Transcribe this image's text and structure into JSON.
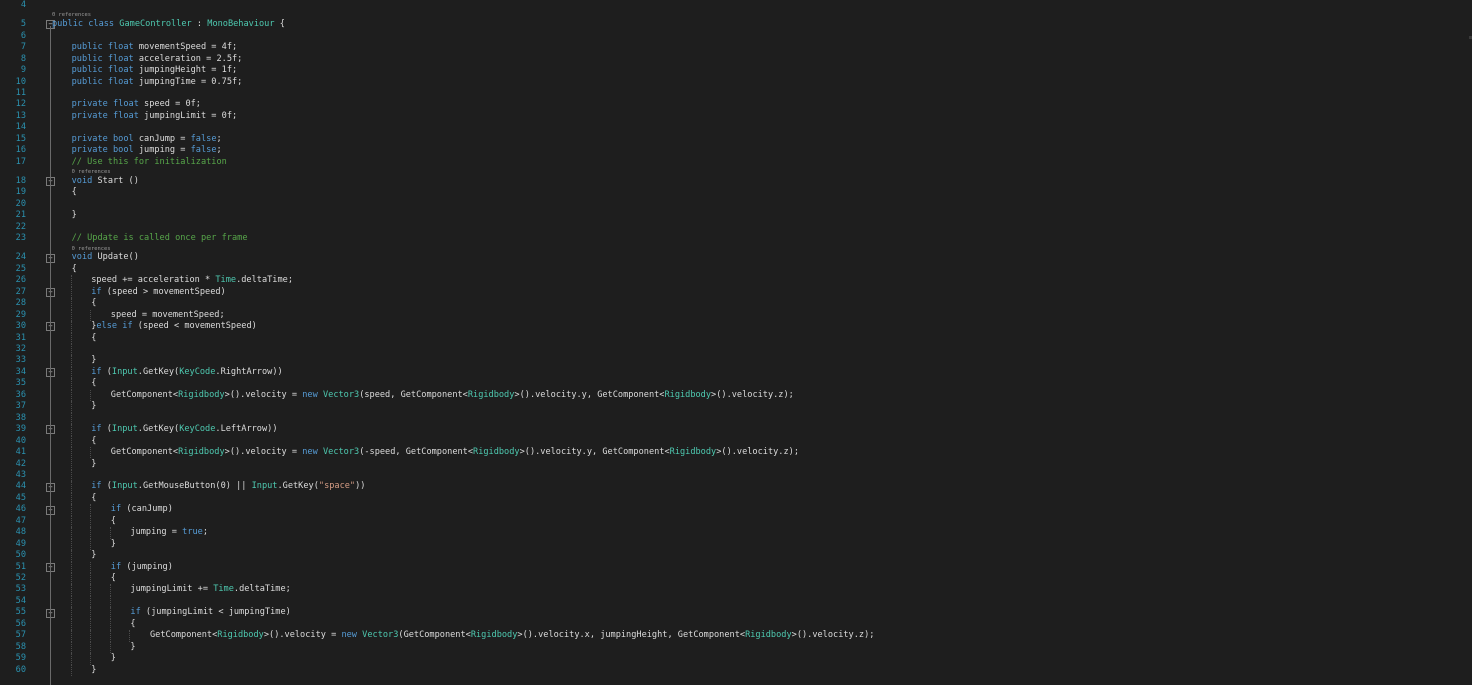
{
  "editor": {
    "language": "C#",
    "colors": {
      "background": "#1e1e1e",
      "line_number": "#2b91af",
      "keyword": "#569cd6",
      "type": "#4ec9b0",
      "comment": "#57a64a",
      "string": "#d69d85",
      "number": "#b5cea8",
      "text": "#dcdcdc",
      "codelens": "#999999"
    },
    "lines": [
      {
        "n": "4",
        "indent": 0,
        "tokens": []
      },
      {
        "lens": "0 references",
        "indent": 0
      },
      {
        "n": "5",
        "indent": 0,
        "fold": "minus",
        "tokens": [
          [
            "kw",
            "public"
          ],
          [
            "plain",
            " "
          ],
          [
            "kw",
            "class"
          ],
          [
            "plain",
            " "
          ],
          [
            "type",
            "GameController"
          ],
          [
            "plain",
            " : "
          ],
          [
            "type",
            "MonoBehaviour"
          ],
          [
            "plain",
            " {"
          ]
        ]
      },
      {
        "n": "6",
        "indent": 0,
        "tokens": []
      },
      {
        "n": "7",
        "indent": 1,
        "tokens": [
          [
            "kw",
            "public"
          ],
          [
            "plain",
            " "
          ],
          [
            "kw",
            "float"
          ],
          [
            "plain",
            " movementSpeed = 4f;"
          ]
        ]
      },
      {
        "n": "8",
        "indent": 1,
        "tokens": [
          [
            "kw",
            "public"
          ],
          [
            "plain",
            " "
          ],
          [
            "kw",
            "float"
          ],
          [
            "plain",
            " acceleration = 2.5f;"
          ]
        ]
      },
      {
        "n": "9",
        "indent": 1,
        "tokens": [
          [
            "kw",
            "public"
          ],
          [
            "plain",
            " "
          ],
          [
            "kw",
            "float"
          ],
          [
            "plain",
            " jumpingHeight = 1f;"
          ]
        ]
      },
      {
        "n": "10",
        "indent": 1,
        "tokens": [
          [
            "kw",
            "public"
          ],
          [
            "plain",
            " "
          ],
          [
            "kw",
            "float"
          ],
          [
            "plain",
            " jumpingTime = 0.75f;"
          ]
        ]
      },
      {
        "n": "11",
        "indent": 1,
        "tokens": []
      },
      {
        "n": "12",
        "indent": 1,
        "tokens": [
          [
            "kw",
            "private"
          ],
          [
            "plain",
            " "
          ],
          [
            "kw",
            "float"
          ],
          [
            "plain",
            " speed = 0f;"
          ]
        ]
      },
      {
        "n": "13",
        "indent": 1,
        "tokens": [
          [
            "kw",
            "private"
          ],
          [
            "plain",
            " "
          ],
          [
            "kw",
            "float"
          ],
          [
            "plain",
            " jumpingLimit = 0f;"
          ]
        ]
      },
      {
        "n": "14",
        "indent": 1,
        "tokens": []
      },
      {
        "n": "15",
        "indent": 1,
        "tokens": [
          [
            "kw",
            "private"
          ],
          [
            "plain",
            " "
          ],
          [
            "kw",
            "bool"
          ],
          [
            "plain",
            " canJump = "
          ],
          [
            "kw",
            "false"
          ],
          [
            "plain",
            ";"
          ]
        ]
      },
      {
        "n": "16",
        "indent": 1,
        "tokens": [
          [
            "kw",
            "private"
          ],
          [
            "plain",
            " "
          ],
          [
            "kw",
            "bool"
          ],
          [
            "plain",
            " jumping = "
          ],
          [
            "kw",
            "false"
          ],
          [
            "plain",
            ";"
          ]
        ]
      },
      {
        "n": "17",
        "indent": 1,
        "tokens": [
          [
            "com",
            "// Use this for initialization"
          ]
        ]
      },
      {
        "lens": "0 references",
        "indent": 1
      },
      {
        "n": "18",
        "indent": 1,
        "fold": "minus",
        "tokens": [
          [
            "kw",
            "void"
          ],
          [
            "plain",
            " Start ()"
          ]
        ]
      },
      {
        "n": "19",
        "indent": 1,
        "tokens": [
          [
            "plain",
            "{"
          ]
        ]
      },
      {
        "n": "20",
        "indent": 1,
        "tokens": []
      },
      {
        "n": "21",
        "indent": 1,
        "tokens": [
          [
            "plain",
            "}"
          ]
        ]
      },
      {
        "n": "22",
        "indent": 1,
        "tokens": []
      },
      {
        "n": "23",
        "indent": 1,
        "tokens": [
          [
            "com",
            "// Update is called once per frame"
          ]
        ]
      },
      {
        "lens": "0 references",
        "indent": 1
      },
      {
        "n": "24",
        "indent": 1,
        "fold": "minus",
        "tokens": [
          [
            "kw",
            "void"
          ],
          [
            "plain",
            " Update()"
          ]
        ]
      },
      {
        "n": "25",
        "indent": 1,
        "tokens": [
          [
            "plain",
            "{"
          ]
        ]
      },
      {
        "n": "26",
        "indent": 2,
        "tokens": [
          [
            "plain",
            "speed += acceleration * "
          ],
          [
            "type",
            "Time"
          ],
          [
            "plain",
            ".deltaTime;"
          ]
        ]
      },
      {
        "n": "27",
        "indent": 2,
        "fold": "minus",
        "tokens": [
          [
            "kw",
            "if"
          ],
          [
            "plain",
            " (speed > movementSpeed)"
          ]
        ]
      },
      {
        "n": "28",
        "indent": 2,
        "tokens": [
          [
            "plain",
            "{"
          ]
        ]
      },
      {
        "n": "29",
        "indent": 3,
        "tokens": [
          [
            "plain",
            "speed = movementSpeed;"
          ]
        ]
      },
      {
        "n": "30",
        "indent": 2,
        "fold": "minus",
        "tokens": [
          [
            "plain",
            "}"
          ],
          [
            "kw",
            "else"
          ],
          [
            "plain",
            " "
          ],
          [
            "kw",
            "if"
          ],
          [
            "plain",
            " (speed < movementSpeed)"
          ]
        ]
      },
      {
        "n": "31",
        "indent": 2,
        "tokens": [
          [
            "plain",
            "{"
          ]
        ]
      },
      {
        "n": "32",
        "indent": 2,
        "tokens": []
      },
      {
        "n": "33",
        "indent": 2,
        "tokens": [
          [
            "plain",
            "}"
          ]
        ]
      },
      {
        "n": "34",
        "indent": 2,
        "fold": "minus",
        "tokens": [
          [
            "kw",
            "if"
          ],
          [
            "plain",
            " ("
          ],
          [
            "type",
            "Input"
          ],
          [
            "plain",
            ".GetKey("
          ],
          [
            "type",
            "KeyCode"
          ],
          [
            "plain",
            ".RightArrow))"
          ]
        ]
      },
      {
        "n": "35",
        "indent": 2,
        "tokens": [
          [
            "plain",
            "{"
          ]
        ]
      },
      {
        "n": "36",
        "indent": 3,
        "tokens": [
          [
            "plain",
            "GetComponent<"
          ],
          [
            "type",
            "Rigidbody"
          ],
          [
            "plain",
            ">().velocity = "
          ],
          [
            "kw",
            "new"
          ],
          [
            "plain",
            " "
          ],
          [
            "type",
            "Vector3"
          ],
          [
            "plain",
            "(speed, GetComponent<"
          ],
          [
            "type",
            "Rigidbody"
          ],
          [
            "plain",
            ">().velocity.y, GetComponent<"
          ],
          [
            "type",
            "Rigidbody"
          ],
          [
            "plain",
            ">().velocity.z);"
          ]
        ]
      },
      {
        "n": "37",
        "indent": 2,
        "tokens": [
          [
            "plain",
            "}"
          ]
        ]
      },
      {
        "n": "38",
        "indent": 2,
        "tokens": []
      },
      {
        "n": "39",
        "indent": 2,
        "fold": "minus",
        "tokens": [
          [
            "kw",
            "if"
          ],
          [
            "plain",
            " ("
          ],
          [
            "type",
            "Input"
          ],
          [
            "plain",
            ".GetKey("
          ],
          [
            "type",
            "KeyCode"
          ],
          [
            "plain",
            ".LeftArrow))"
          ]
        ]
      },
      {
        "n": "40",
        "indent": 2,
        "tokens": [
          [
            "plain",
            "{"
          ]
        ]
      },
      {
        "n": "41",
        "indent": 3,
        "tokens": [
          [
            "plain",
            "GetComponent<"
          ],
          [
            "type",
            "Rigidbody"
          ],
          [
            "plain",
            ">().velocity = "
          ],
          [
            "kw",
            "new"
          ],
          [
            "plain",
            " "
          ],
          [
            "type",
            "Vector3"
          ],
          [
            "plain",
            "(-speed, GetComponent<"
          ],
          [
            "type",
            "Rigidbody"
          ],
          [
            "plain",
            ">().velocity.y, GetComponent<"
          ],
          [
            "type",
            "Rigidbody"
          ],
          [
            "plain",
            ">().velocity.z);"
          ]
        ]
      },
      {
        "n": "42",
        "indent": 2,
        "tokens": [
          [
            "plain",
            "}"
          ]
        ]
      },
      {
        "n": "43",
        "indent": 2,
        "tokens": []
      },
      {
        "n": "44",
        "indent": 2,
        "fold": "minus",
        "tokens": [
          [
            "kw",
            "if"
          ],
          [
            "plain",
            " ("
          ],
          [
            "type",
            "Input"
          ],
          [
            "plain",
            ".GetMouseButton(0) || "
          ],
          [
            "type",
            "Input"
          ],
          [
            "plain",
            ".GetKey("
          ],
          [
            "str",
            "\"space\""
          ],
          [
            "plain",
            "))"
          ]
        ]
      },
      {
        "n": "45",
        "indent": 2,
        "tokens": [
          [
            "plain",
            "{"
          ]
        ]
      },
      {
        "n": "46",
        "indent": 3,
        "fold": "minus",
        "tokens": [
          [
            "kw",
            "if"
          ],
          [
            "plain",
            " (canJump)"
          ]
        ]
      },
      {
        "n": "47",
        "indent": 3,
        "tokens": [
          [
            "plain",
            "{"
          ]
        ]
      },
      {
        "n": "48",
        "indent": 4,
        "tokens": [
          [
            "plain",
            "jumping = "
          ],
          [
            "kw",
            "true"
          ],
          [
            "plain",
            ";"
          ]
        ]
      },
      {
        "n": "49",
        "indent": 3,
        "tokens": [
          [
            "plain",
            "}"
          ]
        ]
      },
      {
        "n": "50",
        "indent": 2,
        "tokens": [
          [
            "plain",
            "}"
          ]
        ]
      },
      {
        "n": "51",
        "indent": 3,
        "fold": "minus",
        "tokens": [
          [
            "kw",
            "if"
          ],
          [
            "plain",
            " (jumping)"
          ]
        ]
      },
      {
        "n": "52",
        "indent": 3,
        "tokens": [
          [
            "plain",
            "{"
          ]
        ]
      },
      {
        "n": "53",
        "indent": 4,
        "tokens": [
          [
            "plain",
            "jumpingLimit += "
          ],
          [
            "type",
            "Time"
          ],
          [
            "plain",
            ".deltaTime;"
          ]
        ]
      },
      {
        "n": "54",
        "indent": 4,
        "tokens": []
      },
      {
        "n": "55",
        "indent": 4,
        "fold": "minus",
        "tokens": [
          [
            "kw",
            "if"
          ],
          [
            "plain",
            " (jumpingLimit < jumpingTime)"
          ]
        ]
      },
      {
        "n": "56",
        "indent": 4,
        "tokens": [
          [
            "plain",
            "{"
          ]
        ]
      },
      {
        "n": "57",
        "indent": 5,
        "tokens": [
          [
            "plain",
            "GetComponent<"
          ],
          [
            "type",
            "Rigidbody"
          ],
          [
            "plain",
            ">().velocity = "
          ],
          [
            "kw",
            "new"
          ],
          [
            "plain",
            " "
          ],
          [
            "type",
            "Vector3"
          ],
          [
            "plain",
            "(GetComponent<"
          ],
          [
            "type",
            "Rigidbody"
          ],
          [
            "plain",
            ">().velocity.x, jumpingHeight, GetComponent<"
          ],
          [
            "type",
            "Rigidbody"
          ],
          [
            "plain",
            ">().velocity.z);"
          ]
        ]
      },
      {
        "n": "58",
        "indent": 4,
        "tokens": [
          [
            "plain",
            "}"
          ]
        ]
      },
      {
        "n": "59",
        "indent": 3,
        "tokens": [
          [
            "plain",
            "}"
          ]
        ]
      },
      {
        "n": "60",
        "indent": 2,
        "tokens": [
          [
            "plain",
            "}"
          ]
        ]
      }
    ]
  }
}
